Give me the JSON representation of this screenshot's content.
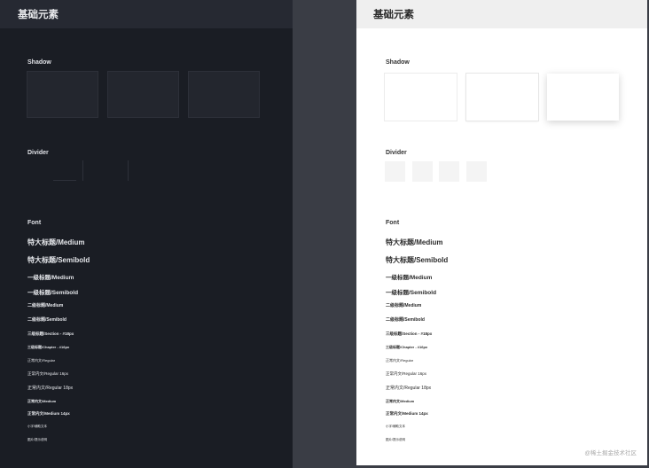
{
  "dark": {
    "title": "基础元素"
  },
  "light": {
    "title": "基础元素"
  },
  "sections": {
    "shadow": "Shadow",
    "divider": "Divider",
    "font": "Font"
  },
  "fonts": [
    "特大标题/Medium",
    "特大标题/Semibold",
    "一级标题/Medium",
    "一级标题/Semibold",
    "二级标题/Medium",
    "二级标题/Semibold",
    "三级标题/Section - #18px",
    "三级标题/Chapter - #16px",
    "正常内文/Regular",
    "正常内文/Regular 16px",
    "正常内文/Regular 18px",
    "正常内文/Medium",
    "正常内文/Medium 14px",
    "小字/辅助文本",
    "图片/提示说明"
  ],
  "watermark": "@稀土掘金技术社区",
  "colors": {
    "dark_bg": "#1a1d24",
    "light_bg": "#ffffff",
    "gutter": "#3a3d45"
  }
}
